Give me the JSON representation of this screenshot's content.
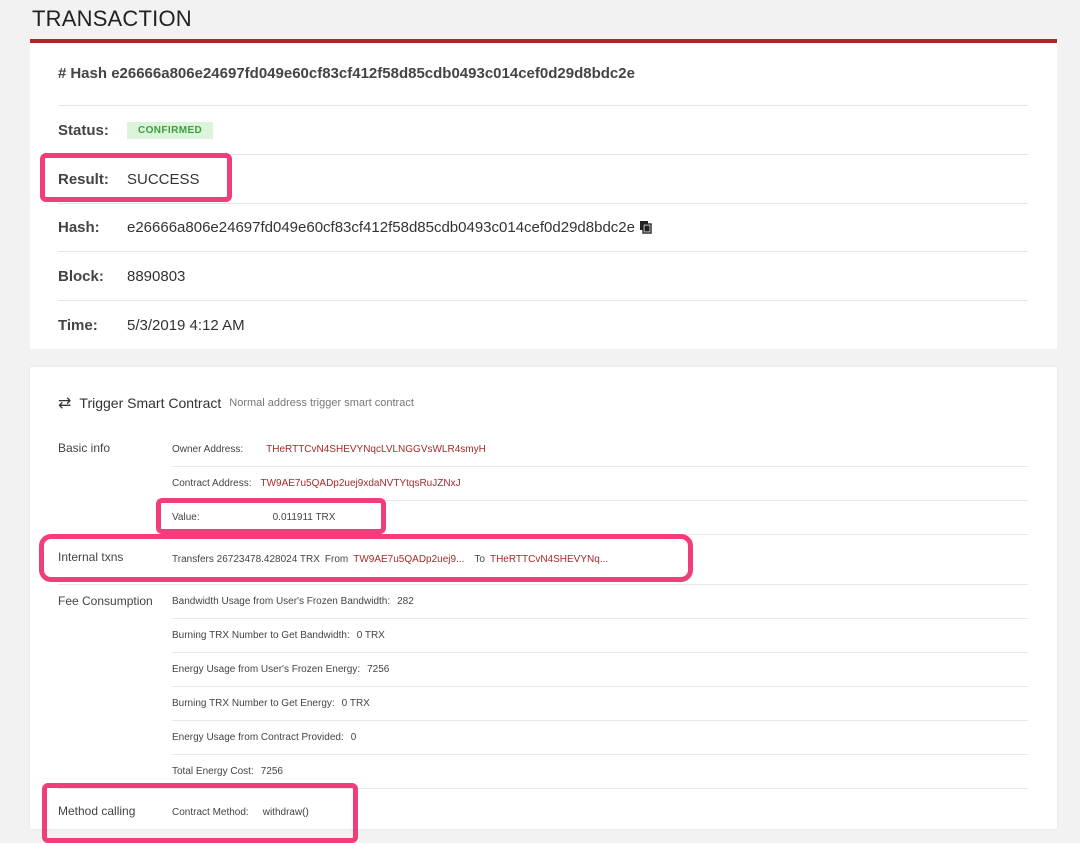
{
  "page": {
    "title": "TRANSACTION"
  },
  "summary": {
    "hash_prefix": "#",
    "hash_heading": "Hash e26666a806e24697fd049e60cf83cf412f58d85cdb0493c014cef0d29d8bdc2e",
    "status_label": "Status:",
    "status_value": "CONFIRMED",
    "result_label": "Result:",
    "result_value": "SUCCESS",
    "hash_label": "Hash:",
    "hash_value": "e26666a806e24697fd049e60cf83cf412f58d85cdb0493c014cef0d29d8bdc2e",
    "block_label": "Block:",
    "block_value": "8890803",
    "time_label": "Time:",
    "time_value": "5/3/2019 4:12 AM"
  },
  "contract": {
    "title": "Trigger Smart Contract",
    "subtitle": "Normal address trigger smart contract",
    "basic_info": {
      "label": "Basic info",
      "owner_label": "Owner Address:",
      "owner_value": "THeRTTCvN4SHEVYNqcLVLNGGVsWLR4smyH",
      "contract_label": "Contract Address:",
      "contract_value": "TW9AE7u5QADp2uej9xdaNVTYtqsRuJZNxJ",
      "value_label": "Value:",
      "value_value": "0.011911 TRX"
    },
    "internal": {
      "label": "Internal txns",
      "transfers_text": "Transfers 26723478.428024 TRX",
      "from_label": "From",
      "from_value": "TW9AE7u5QADp2uej9...",
      "to_label": "To",
      "to_value": "THeRTTCvN4SHEVYNq..."
    },
    "fee": {
      "label": "Fee Consumption",
      "rows": [
        {
          "k": "Bandwidth Usage from User's Frozen Bandwidth:",
          "v": "282"
        },
        {
          "k": "Burning TRX Number to Get Bandwidth:",
          "v": "0 TRX"
        },
        {
          "k": "Energy Usage from User's Frozen Energy:",
          "v": "7256"
        },
        {
          "k": "Burning TRX Number to Get Energy:",
          "v": "0 TRX"
        },
        {
          "k": "Energy Usage from Contract Provided:",
          "v": "0"
        },
        {
          "k": "Total Energy Cost:",
          "v": "7256"
        }
      ]
    },
    "method": {
      "label": "Method calling",
      "method_label": "Contract Method:",
      "method_value": "withdraw()"
    }
  },
  "colors": {
    "accent": "#a52a2a",
    "highlight": "#ef3e7b",
    "confirmed_bg": "#dcf3dc",
    "confirmed_text": "#3aa23a"
  }
}
